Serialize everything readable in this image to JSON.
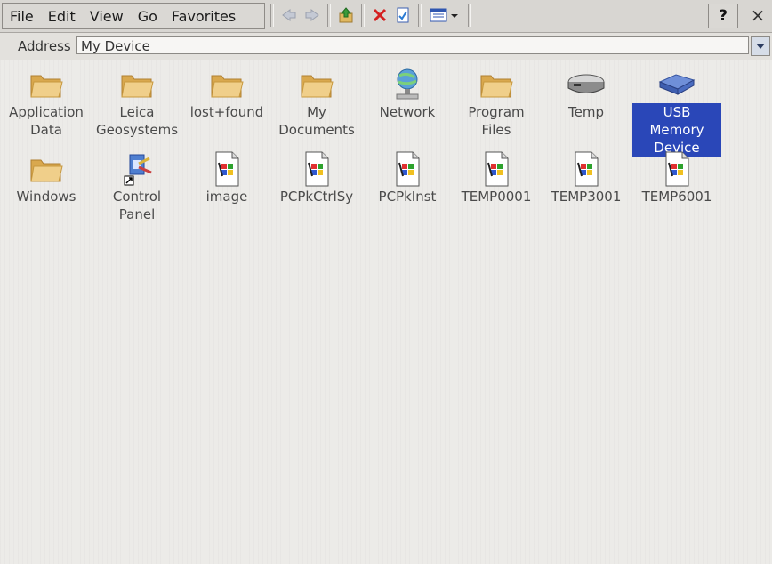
{
  "menu": {
    "file": "File",
    "edit": "Edit",
    "view": "View",
    "go": "Go",
    "favorites": "Favorites"
  },
  "titlebar": {
    "help_label": "?",
    "close_label": "×"
  },
  "address": {
    "label": "Address",
    "value": "My Device"
  },
  "items": [
    {
      "label": "Application Data",
      "type": "folder"
    },
    {
      "label": "Leica Geosystems",
      "type": "folder"
    },
    {
      "label": "lost+found",
      "type": "folder"
    },
    {
      "label": "My Documents",
      "type": "folder"
    },
    {
      "label": "Network",
      "type": "network"
    },
    {
      "label": "Program Files",
      "type": "folder"
    },
    {
      "label": "Temp",
      "type": "drive"
    },
    {
      "label": "USB Memory Device",
      "type": "usb",
      "selected": true
    },
    {
      "label": "Windows",
      "type": "folder"
    },
    {
      "label": "Control Panel",
      "type": "control-panel"
    },
    {
      "label": "image",
      "type": "file"
    },
    {
      "label": "PCPkCtrlSy",
      "type": "file"
    },
    {
      "label": "PCPkInst",
      "type": "file"
    },
    {
      "label": "TEMP0001",
      "type": "file"
    },
    {
      "label": "TEMP3001",
      "type": "file"
    },
    {
      "label": "TEMP6001",
      "type": "file"
    }
  ],
  "colors": {
    "selection": "#2a47b8",
    "folder": "#e8c27a"
  }
}
